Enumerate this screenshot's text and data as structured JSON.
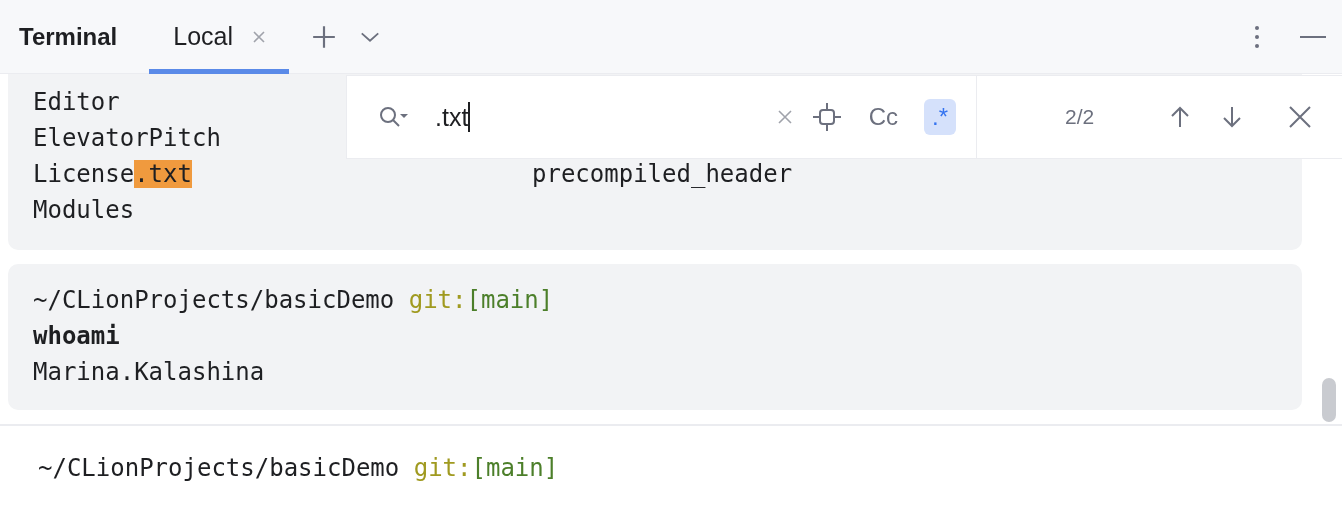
{
  "header": {
    "title": "Terminal",
    "tabs": [
      {
        "label": "Local",
        "selected": true
      }
    ]
  },
  "blocks": [
    {
      "lines": [
        {
          "cells": [
            [
              {
                "text": "Editor",
                "kind": "plain"
              }
            ]
          ]
        },
        {
          "cells": [
            [
              {
                "text": "ElevatorPitch",
                "kind": "plain"
              }
            ]
          ]
        },
        {
          "cells": [
            [
              {
                "text": "License",
                "kind": "plain"
              },
              {
                "text": ".txt",
                "kind": "match"
              }
            ],
            [
              {
                "text": "precompiled_header",
                "kind": "plain"
              }
            ]
          ]
        },
        {
          "cells": [
            [
              {
                "text": "Modules",
                "kind": "plain"
              }
            ]
          ]
        }
      ]
    },
    {
      "lines": [
        {
          "cells": [
            [
              {
                "text": "~/CLionProjects/basicDemo ",
                "kind": "plain"
              },
              {
                "text": "git:",
                "kind": "git"
              },
              {
                "text": "[main]",
                "kind": "branch"
              }
            ]
          ]
        },
        {
          "cells": [
            [
              {
                "text": "whoami",
                "kind": "command"
              }
            ]
          ]
        },
        {
          "cells": [
            [
              {
                "text": "Marina.Kalashina",
                "kind": "plain"
              }
            ]
          ]
        }
      ]
    }
  ],
  "prompt": [
    {
      "text": "~/CLionProjects/basicDemo ",
      "kind": "plain"
    },
    {
      "text": "git:",
      "kind": "git"
    },
    {
      "text": "[main]",
      "kind": "branch"
    }
  ],
  "search": {
    "query": ".txt",
    "match_case": {
      "label": "Cc",
      "selected": false
    },
    "regex": {
      "label": ".*",
      "selected": true
    },
    "count": "2/2"
  }
}
